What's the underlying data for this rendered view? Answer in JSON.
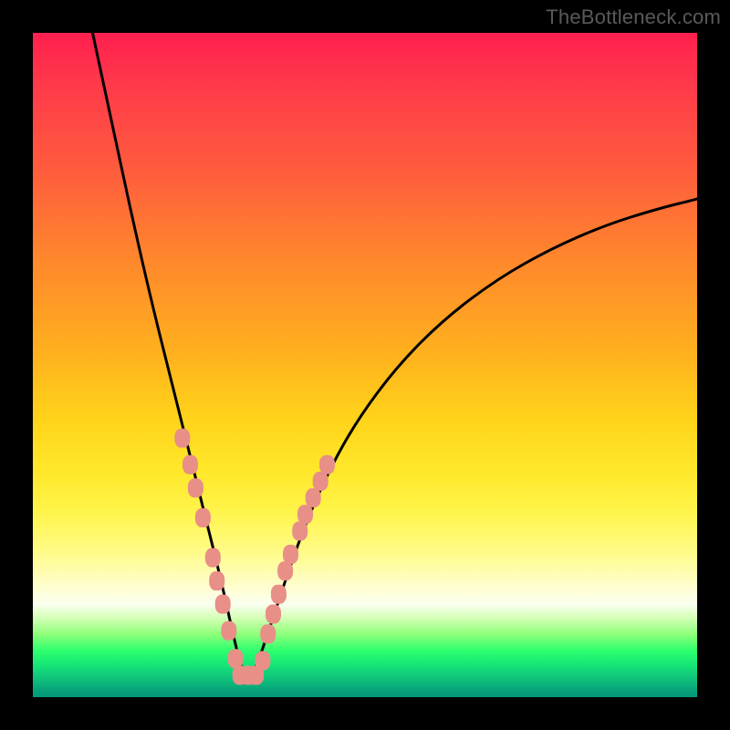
{
  "watermark": "TheBottleneck.com",
  "chart_data": {
    "type": "line",
    "title": "",
    "xlabel": "",
    "ylabel": "",
    "xlim": [
      0,
      100
    ],
    "ylim": [
      0,
      100
    ],
    "grid": false,
    "legend": false,
    "notes": "Axes are unlabeled in the source image; values are estimated from pixel positions on a 0–100 normalized scale. Curve is a V/notch shape bottoming out near x≈31, y≈3. Salmon-colored beads cluster along both flanks of the notch.",
    "series": [
      {
        "name": "bottleneck-curve",
        "color": "#000000",
        "x": [
          9.0,
          12.0,
          15.0,
          18.0,
          20.5,
          22.5,
          24.5,
          26.0,
          27.5,
          28.8,
          29.8,
          30.6,
          31.3,
          32.0,
          32.8,
          33.8,
          35.0,
          36.5,
          38.5,
          41.0,
          44.5,
          49.0,
          55.0,
          62.0,
          70.0,
          78.0,
          86.0,
          94.0,
          100.0
        ],
        "y": [
          100.0,
          86.0,
          72.0,
          59.0,
          49.0,
          41.0,
          33.0,
          27.0,
          21.0,
          15.5,
          11.0,
          7.5,
          4.8,
          3.2,
          3.2,
          5.0,
          8.5,
          13.0,
          19.0,
          26.0,
          34.0,
          42.0,
          50.0,
          57.0,
          63.0,
          67.5,
          71.0,
          73.5,
          75.0
        ]
      }
    ],
    "markers": [
      {
        "name": "beads",
        "color": "#e88f88",
        "shape": "rounded-square",
        "points": [
          {
            "x": 22.5,
            "y": 39.0
          },
          {
            "x": 23.7,
            "y": 35.0
          },
          {
            "x": 24.5,
            "y": 31.5
          },
          {
            "x": 25.6,
            "y": 27.0
          },
          {
            "x": 27.1,
            "y": 21.0
          },
          {
            "x": 27.7,
            "y": 17.5
          },
          {
            "x": 28.6,
            "y": 14.0
          },
          {
            "x": 29.5,
            "y": 10.0
          },
          {
            "x": 30.5,
            "y": 5.8
          },
          {
            "x": 31.2,
            "y": 3.3
          },
          {
            "x": 32.5,
            "y": 3.3
          },
          {
            "x": 33.6,
            "y": 3.3
          },
          {
            "x": 34.6,
            "y": 5.5
          },
          {
            "x": 35.4,
            "y": 9.5
          },
          {
            "x": 36.2,
            "y": 12.5
          },
          {
            "x": 37.0,
            "y": 15.5
          },
          {
            "x": 38.0,
            "y": 19.0
          },
          {
            "x": 38.8,
            "y": 21.5
          },
          {
            "x": 40.2,
            "y": 25.0
          },
          {
            "x": 41.0,
            "y": 27.5
          },
          {
            "x": 42.2,
            "y": 30.0
          },
          {
            "x": 43.3,
            "y": 32.5
          },
          {
            "x": 44.3,
            "y": 35.0
          }
        ]
      }
    ]
  }
}
